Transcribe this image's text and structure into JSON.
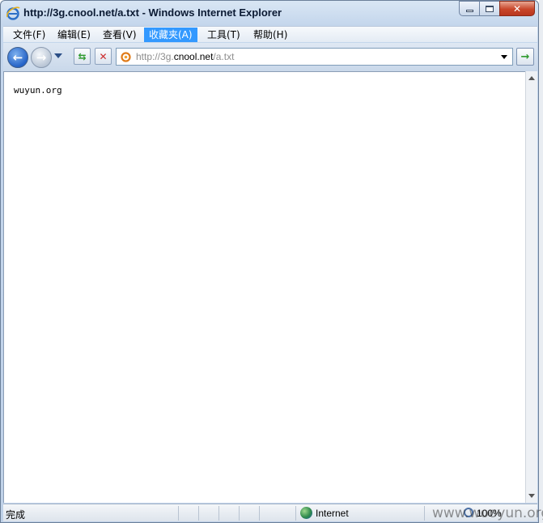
{
  "window": {
    "title": "http://3g.cnool.net/a.txt - Windows Internet Explorer",
    "controls": {
      "minimize": "minimize",
      "maximize": "maximize",
      "close": "✕"
    }
  },
  "menu": {
    "items": [
      {
        "label": "文件(F)"
      },
      {
        "label": "编辑(E)"
      },
      {
        "label": "查看(V)"
      },
      {
        "label": "收藏夹(A)",
        "active": true
      },
      {
        "label": "工具(T)"
      },
      {
        "label": "帮助(H)"
      }
    ]
  },
  "nav": {
    "address_prefix": "http://3g.",
    "address_domain": "cnool.net",
    "address_suffix": "/a.txt",
    "back_glyph": "←",
    "forward_glyph": "→",
    "refresh_glyph": "⇆",
    "stop_glyph": "✕",
    "go_glyph": "→"
  },
  "page": {
    "content": "wuyun.org"
  },
  "status": {
    "text": "完成",
    "zone": "Internet",
    "zoom": "100%"
  },
  "watermark": "www.wooyun.org",
  "colors": {
    "menu_active": "#3399ff",
    "close_button": "#c8462a"
  }
}
